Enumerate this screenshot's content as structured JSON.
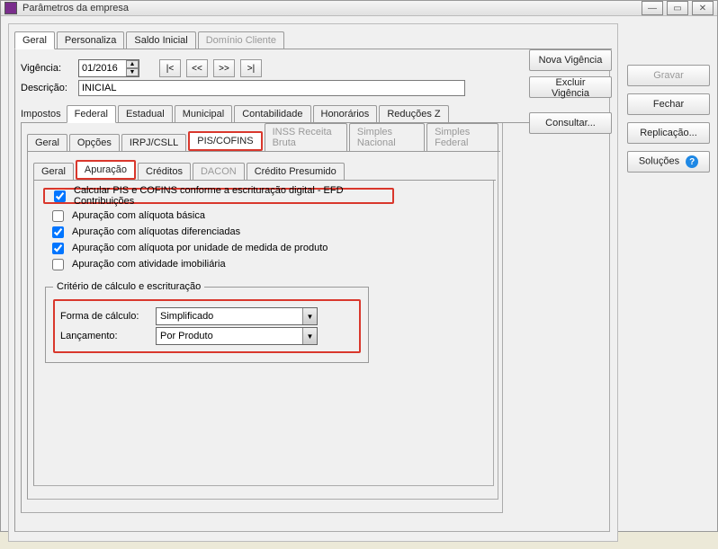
{
  "window": {
    "title": "Parâmetros da empresa"
  },
  "tabs_top": {
    "geral": "Geral",
    "personaliza": "Personaliza",
    "saldo_inicial": "Saldo Inicial",
    "dominio_cliente": "Domínio Cliente"
  },
  "vigencia": {
    "label": "Vigência:",
    "value": "01/2016",
    "nav_first": "|<",
    "nav_prev": "<<",
    "nav_next": ">>",
    "nav_last": ">|"
  },
  "descricao": {
    "label": "Descrição:",
    "value": "INICIAL"
  },
  "tabs_imp": {
    "title": "Impostos",
    "federal": "Federal",
    "estadual": "Estadual",
    "municipal": "Municipal",
    "contabilidade": "Contabilidade",
    "honorarios": "Honorários",
    "reducoesz": "Reduções Z"
  },
  "tabs_fed": {
    "geral": "Geral",
    "opcoes": "Opções",
    "irpj": "IRPJ/CSLL",
    "pis": "PIS/COFINS",
    "inss": "INSS Receita Bruta",
    "sn": "Simples Nacional",
    "sf": "Simples Federal"
  },
  "tabs_pis": {
    "geral": "Geral",
    "apuracao": "Apuração",
    "creditos": "Créditos",
    "dacon": "DACON",
    "credpres": "Crédito Presumido"
  },
  "checks": {
    "efd": "Calcular PIS e COFINS conforme a escrituração digital - EFD Contribuições",
    "basica": "Apuração com alíquota básica",
    "difer": "Apuração com alíquotas diferenciadas",
    "unidade": "Apuração com alíquota por unidade de medida de produto",
    "imob": "Apuração com atividade imobiliária"
  },
  "criterio": {
    "legend": "Critério de cálculo e escrituração",
    "forma_lbl": "Forma de cálculo:",
    "forma_val": "Simplificado",
    "lanc_lbl": "Lançamento:",
    "lanc_val": "Por Produto"
  },
  "side_inner": {
    "nova": "Nova Vigência",
    "excluir": "Excluir Vigência",
    "consultar": "Consultar..."
  },
  "side_outer": {
    "gravar": "Gravar",
    "fechar": "Fechar",
    "replicacao": "Replicação...",
    "solucoes": "Soluções"
  }
}
